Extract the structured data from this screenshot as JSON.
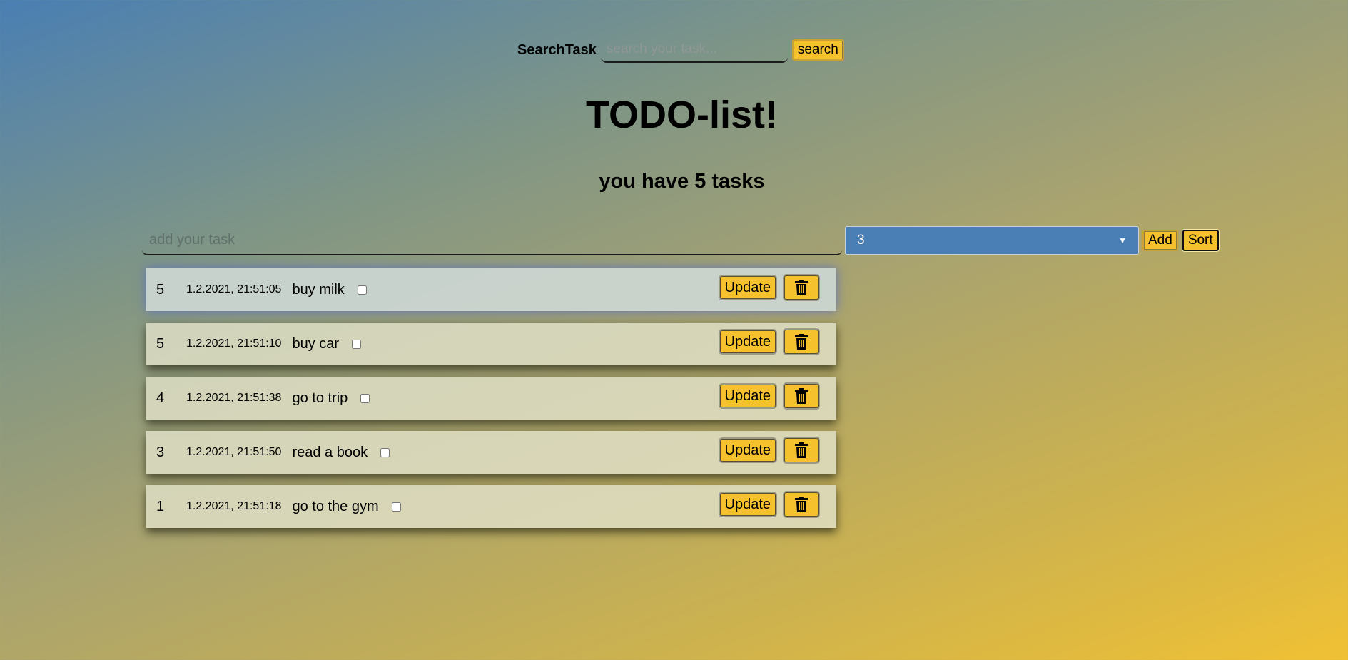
{
  "search": {
    "label": "SearchTask",
    "placeholder": "search your task...",
    "button_label": "search"
  },
  "title": "TODO-list!",
  "subtitle": "you have 5 tasks",
  "add": {
    "placeholder": "add your task",
    "priority_value": "3",
    "add_label": "Add",
    "sort_label": "Sort"
  },
  "tasks": [
    {
      "priority": "5",
      "date": "1.2.2021, 21:51:05",
      "name": "buy milk",
      "update_label": "Update",
      "checked": false
    },
    {
      "priority": "5",
      "date": "1.2.2021, 21:51:10",
      "name": "buy car",
      "update_label": "Update",
      "checked": false
    },
    {
      "priority": "4",
      "date": "1.2.2021, 21:51:38",
      "name": "go to trip",
      "update_label": "Update",
      "checked": false
    },
    {
      "priority": "3",
      "date": "1.2.2021, 21:51:50",
      "name": "read a book",
      "update_label": "Update",
      "checked": false
    },
    {
      "priority": "1",
      "date": "1.2.2021, 21:51:18",
      "name": "go to the gym",
      "update_label": "Update",
      "checked": false
    }
  ],
  "icons": {
    "delete": "trash-icon",
    "select": "chevron-down-icon"
  },
  "colors": {
    "button_yellow": "#f5c22e",
    "select_blue": "#4a7fb6",
    "gradient_top": "#4a7fb3",
    "gradient_bottom": "#f0c134"
  }
}
